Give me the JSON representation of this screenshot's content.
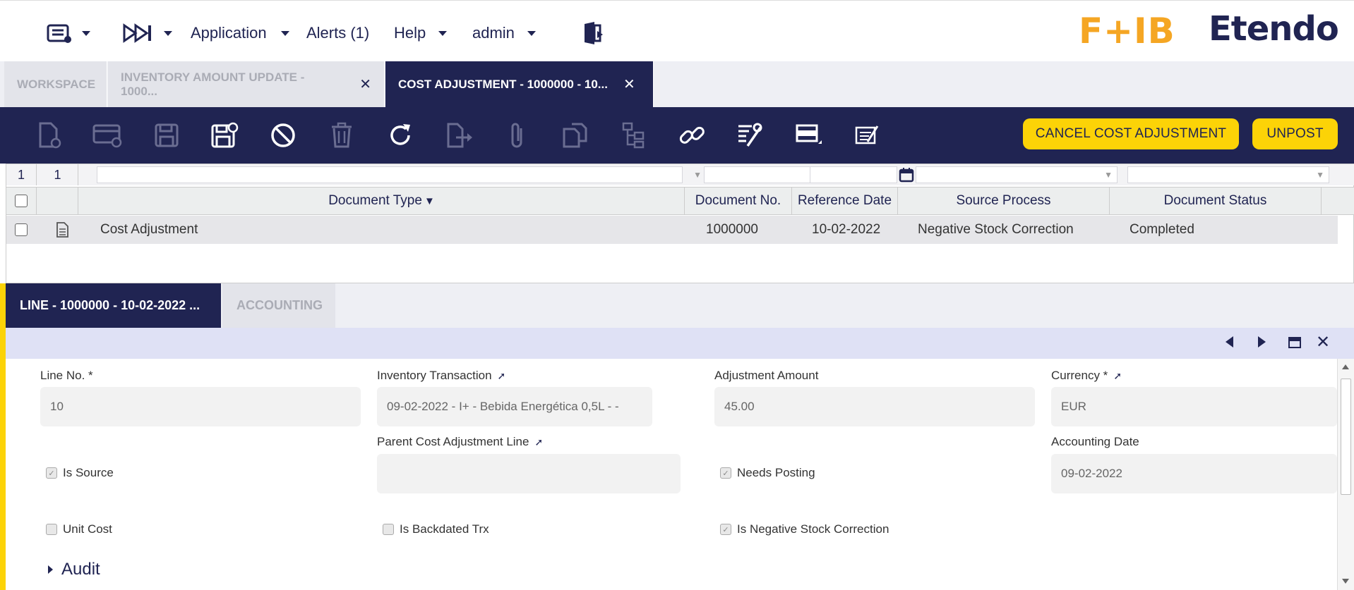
{
  "nav": {
    "application": "Application",
    "alerts": "Alerts (1)",
    "help": "Help",
    "user": "admin",
    "logo_fb": "F+IB",
    "logo_etendo": "Etendo"
  },
  "tabs": [
    {
      "label": "WORKSPACE"
    },
    {
      "label": "INVENTORY AMOUNT UPDATE - 1000..."
    },
    {
      "label": "COST ADJUSTMENT - 1000000 - 10..."
    }
  ],
  "toolbar": {
    "cancel_label": "CANCEL COST ADJUSTMENT",
    "unpost_label": "UNPOST",
    "accent": "#fcd307",
    "bg": "#202452"
  },
  "grid": {
    "filter_counts": [
      "1",
      "1"
    ],
    "columns": [
      "Document Type",
      "Document No.",
      "Reference Date",
      "Source Process",
      "Document Status"
    ],
    "sort_indicator": "▼",
    "rows": [
      {
        "document_type": "Cost Adjustment",
        "document_no": "1000000",
        "reference_date": "10-02-2022",
        "source_process": "Negative Stock Correction",
        "document_status": "Completed"
      }
    ]
  },
  "detail_tabs": [
    {
      "label": "LINE - 1000000 - 10-02-2022 ..."
    },
    {
      "label": "ACCOUNTING"
    }
  ],
  "form": {
    "line_no_label": "Line No. *",
    "line_no": "10",
    "inv_tx_label": "Inventory Transaction",
    "inv_tx": "09-02-2022 - I+ - Bebida Energética 0,5L - -",
    "adj_amount_label": "Adjustment Amount",
    "adj_amount": "45.00",
    "currency_label": "Currency *",
    "currency": "EUR",
    "parent_label": "Parent Cost Adjustment Line",
    "parent": "",
    "accounting_date_label": "Accounting Date",
    "accounting_date": "09-02-2022",
    "is_source": "Is Source",
    "needs_posting": "Needs Posting",
    "unit_cost": "Unit Cost",
    "is_backdated": "Is Backdated Trx",
    "is_negative": "Is Negative Stock Correction",
    "audit": "Audit"
  }
}
